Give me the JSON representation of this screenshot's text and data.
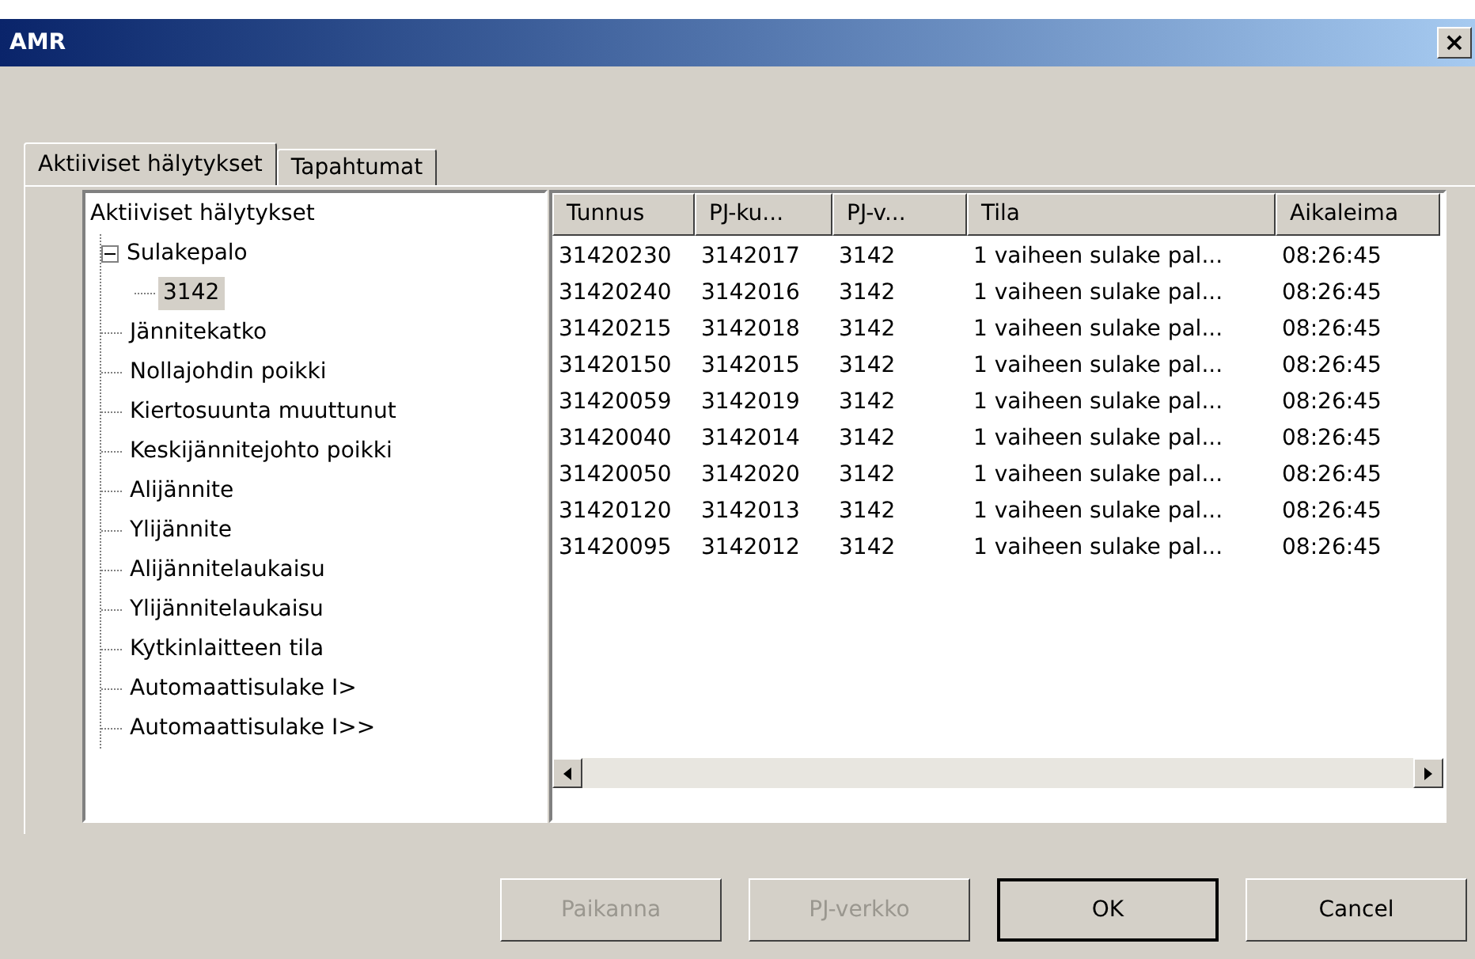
{
  "window": {
    "title": "AMR",
    "close": "×"
  },
  "tabs": [
    {
      "label": "Aktiiviset hälytykset",
      "selected": true
    },
    {
      "label": "Tapahtumat",
      "selected": false
    }
  ],
  "tree": {
    "label": "Aktiiviset hälytykset",
    "children": [
      {
        "label": "Sulakepalo",
        "selected": false,
        "expanded": true,
        "children": [
          {
            "label": "3142",
            "selected": true
          }
        ]
      },
      {
        "label": "Jännitekatko",
        "selected": false
      },
      {
        "label": "Nollajohdin poikki",
        "selected": false
      },
      {
        "label": "Kiertosuunta muuttunut",
        "selected": false
      },
      {
        "label": "Keskijännitejohto poikki",
        "selected": false
      },
      {
        "label": "Alijännite",
        "selected": false
      },
      {
        "label": "Ylijännite",
        "selected": false
      },
      {
        "label": "Alijännitelaukaisu",
        "selected": false
      },
      {
        "label": "Ylijännitelaukaisu",
        "selected": false
      },
      {
        "label": "Kytkinlaitteen tila",
        "selected": false
      },
      {
        "label": "Automaattisulake I>",
        "selected": false
      },
      {
        "label": "Automaattisulake I>>",
        "selected": false
      }
    ]
  },
  "table": {
    "columns": [
      "Tunnus",
      "PJ-ku...",
      "PJ-v...",
      "Tila",
      "Aikaleima"
    ],
    "rows": [
      [
        "31420230",
        "3142017",
        "3142",
        "1 vaiheen sulake pal...",
        "08:26:45"
      ],
      [
        "31420240",
        "3142016",
        "3142",
        "1 vaiheen sulake pal...",
        "08:26:45"
      ],
      [
        "31420215",
        "3142018",
        "3142",
        "1 vaiheen sulake pal...",
        "08:26:45"
      ],
      [
        "31420150",
        "3142015",
        "3142",
        "1 vaiheen sulake pal...",
        "08:26:45"
      ],
      [
        "31420059",
        "3142019",
        "3142",
        "1 vaiheen sulake pal...",
        "08:26:45"
      ],
      [
        "31420040",
        "3142014",
        "3142",
        "1 vaiheen sulake pal...",
        "08:26:45"
      ],
      [
        "31420050",
        "3142020",
        "3142",
        "1 vaiheen sulake pal...",
        "08:26:45"
      ],
      [
        "31420120",
        "3142013",
        "3142",
        "1 vaiheen sulake pal...",
        "08:26:45"
      ],
      [
        "31420095",
        "3142012",
        "3142",
        "1 vaiheen sulake pal...",
        "08:26:45"
      ]
    ]
  },
  "buttons": [
    {
      "label": "Paikanna",
      "disabled": true,
      "default": false
    },
    {
      "label": "PJ-verkko",
      "disabled": true,
      "default": false
    },
    {
      "label": "OK",
      "disabled": false,
      "default": true
    },
    {
      "label": "Cancel",
      "disabled": false,
      "default": false
    }
  ]
}
